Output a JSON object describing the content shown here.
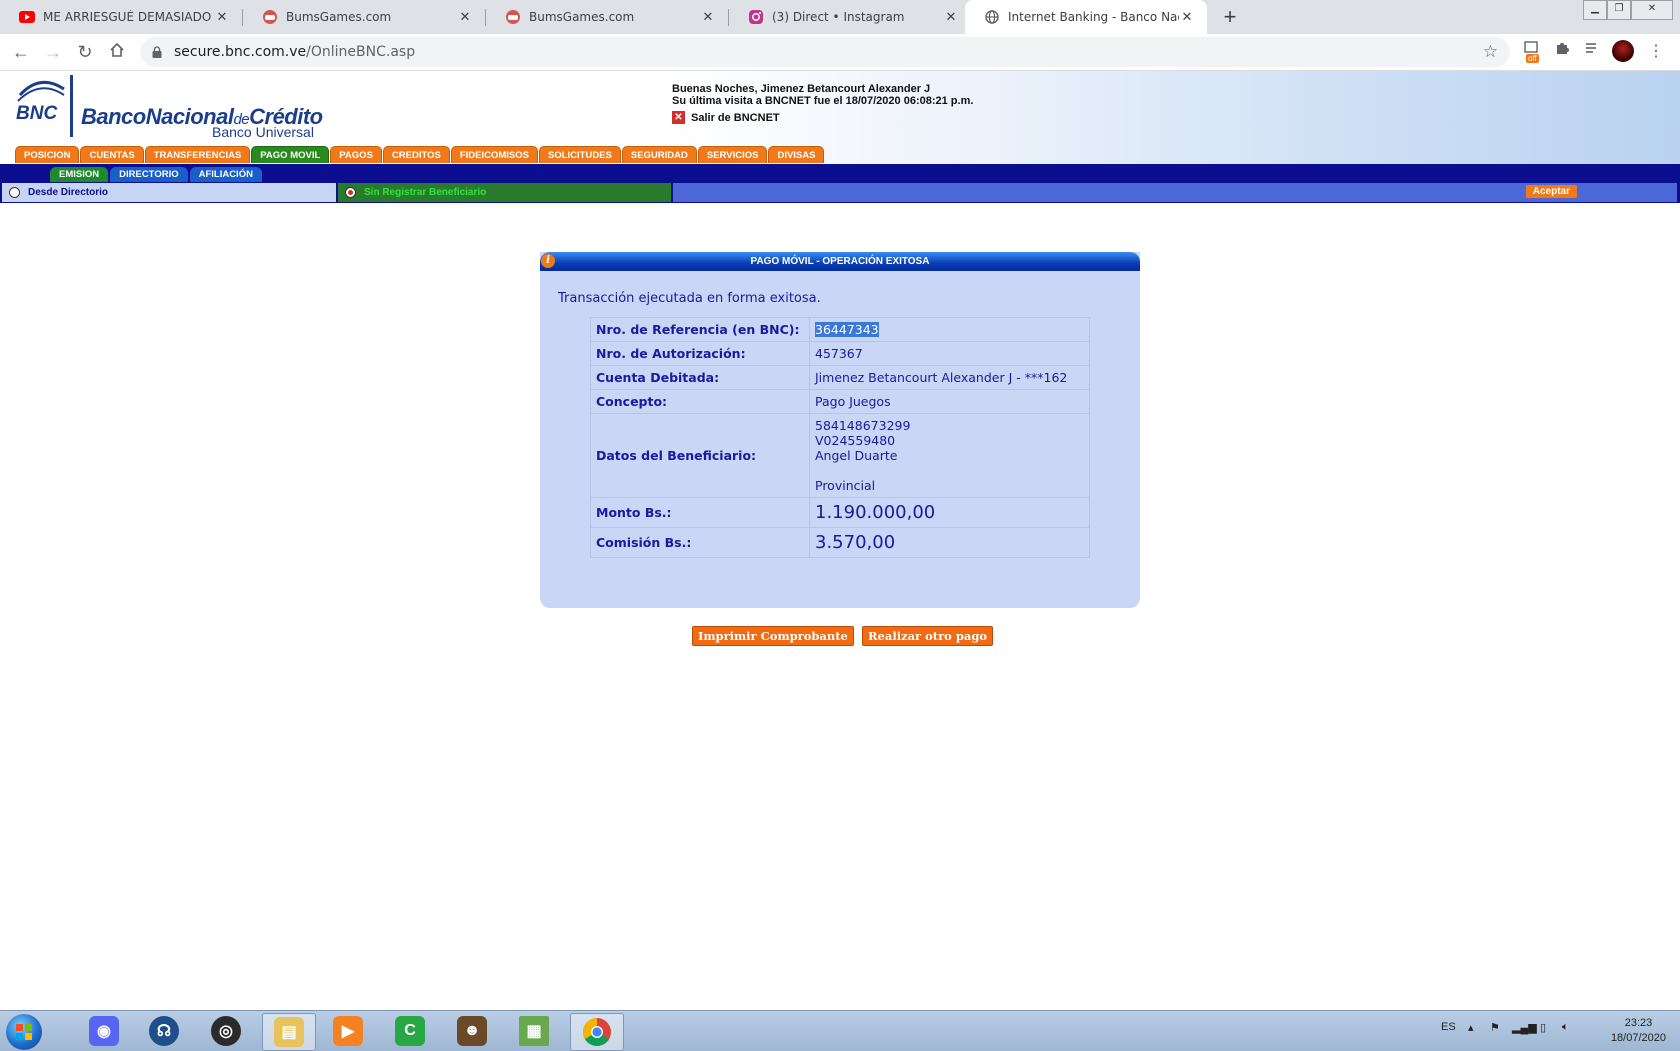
{
  "browser": {
    "tabs": [
      {
        "title": "ME ARRIESGUÉ DEMASIADO YENDO",
        "icon": "youtube-icon"
      },
      {
        "title": "BumsGames.com",
        "icon": "bumsgames-icon"
      },
      {
        "title": "BumsGames.com",
        "icon": "bumsgames-icon"
      },
      {
        "title": "(3) Direct • Instagram",
        "icon": "instagram-icon"
      },
      {
        "title": "Internet Banking - Banco Nacional",
        "icon": "globe-icon"
      }
    ],
    "url_host": "secure.bnc.com.ve",
    "url_path": "/OnlineBNC.asp",
    "extension_badge": "off"
  },
  "bank": {
    "logo_mark": "BNC",
    "name_part1": "BancoNacional",
    "name_part2": "de",
    "name_part3": "Crédito",
    "subtitle": "Banco Universal",
    "greeting": "Buenas Noches, Jimenez Betancourt Alexander J",
    "last_visit": "Su última visita a BNCNET fue el 18/07/2020 06:08:21 p.m.",
    "logout": "Salir de BNCNET",
    "menu": [
      "POSICION",
      "CUENTAS",
      "TRANSFERENCIAS",
      "PAGO MOVIL",
      "PAGOS",
      "CREDITOS",
      "FIDEICOMISOS",
      "SOLICITUDES",
      "SEGURIDAD",
      "SERVICIOS",
      "DIVISAS"
    ],
    "submenu": [
      "EMISION",
      "DIRECTORIO",
      "AFILIACIÓN"
    ],
    "options": {
      "desde_directorio": "Desde Directorio",
      "sin_registrar": "Sin Registrar Beneficiario",
      "aceptar": "Aceptar"
    }
  },
  "result": {
    "title": "PAGO MÓVIL - OPERACIÓN EXITOSA",
    "message": "Transacción ejecutada en forma exitosa.",
    "rows": {
      "ref_label": "Nro. de Referencia (en BNC):",
      "ref_value": "36447343",
      "auth_label": "Nro. de Autorización:",
      "auth_value": "457367",
      "account_label": "Cuenta Debitada:",
      "account_value": "Jimenez Betancourt Alexander J - ***162",
      "concept_label": "Concepto:",
      "concept_value": "Pago Juegos",
      "beneficiary_label": "Datos del Beneficiario:",
      "beneficiary_phone": "584148673299",
      "beneficiary_id": "V024559480",
      "beneficiary_name": "Angel Duarte",
      "beneficiary_bank": "Provincial",
      "amount_label": "Monto Bs.:",
      "amount_value": "1.190.000,00",
      "fee_label": "Comisión Bs.:",
      "fee_value": "3.570,00"
    },
    "buttons": {
      "print": "Imprimir Comprobante",
      "another": "Realizar otro pago"
    }
  },
  "taskbar": {
    "language": "ES",
    "time": "23:23",
    "date": "18/07/2020"
  },
  "colors": {
    "menu_orange": "#f07a1a",
    "menu_active_green": "#2a8a1e",
    "navy": "#0b0f8f",
    "panel_bg": "#c9d6f5",
    "text_blue": "#1a1aa0"
  }
}
